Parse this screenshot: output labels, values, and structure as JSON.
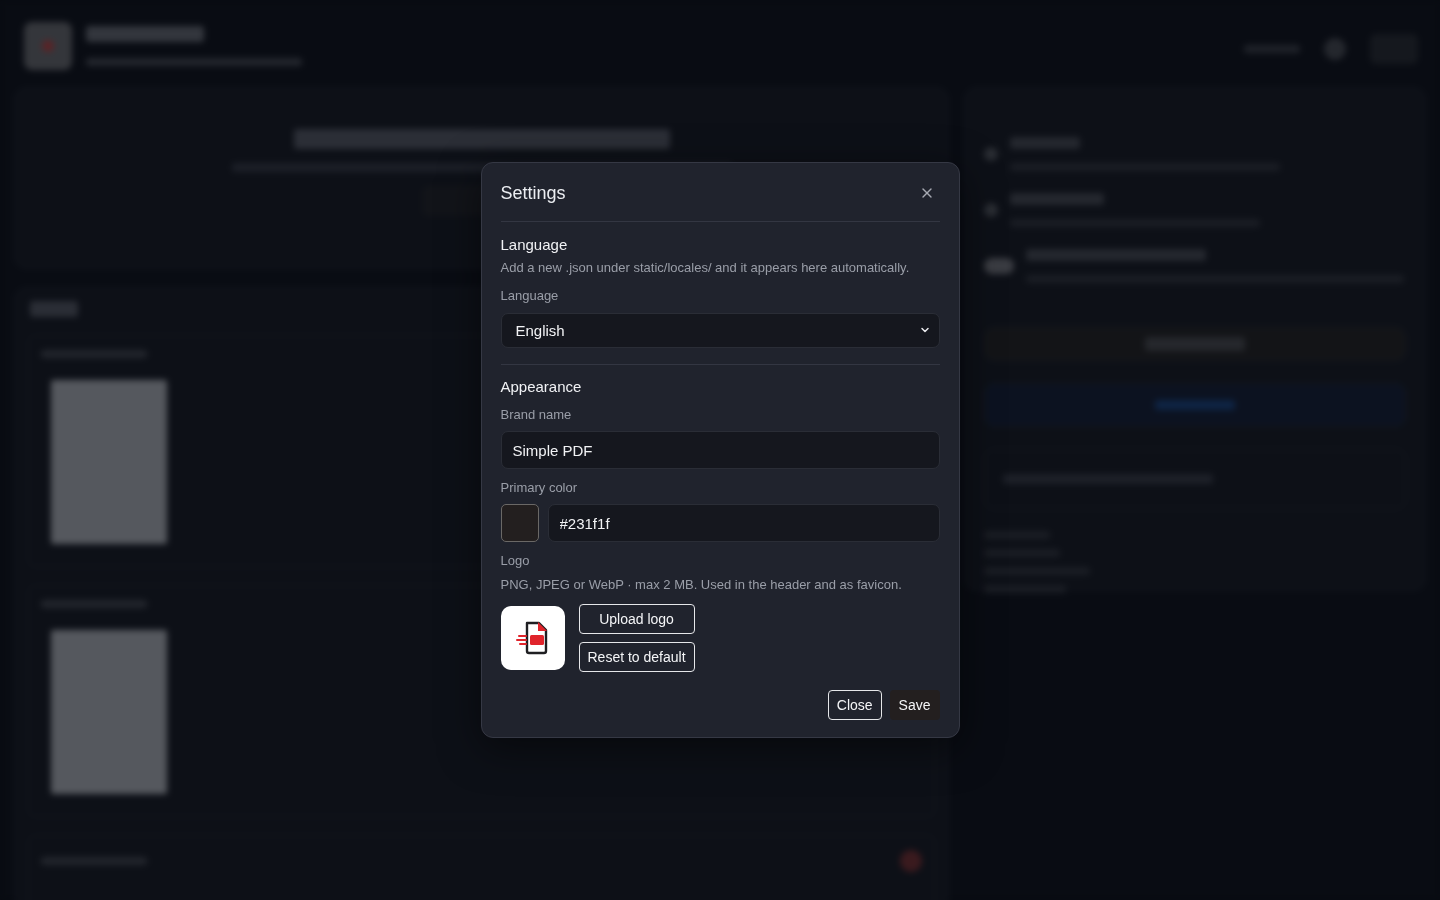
{
  "dialog": {
    "title": "Settings"
  },
  "language_section": {
    "heading": "Language",
    "hint": "Add a new .json under static/locales/ and it appears here automatically.",
    "field": {
      "label": "Language",
      "value": "English"
    }
  },
  "appearance_section": {
    "heading": "Appearance",
    "brand_name": {
      "label": "Brand name",
      "value": "Simple PDF"
    },
    "primary_color": {
      "label": "Primary color",
      "value": "#231f1f",
      "color": "#231f1f"
    },
    "logo": {
      "label": "Logo",
      "hint": "PNG, JPEG or WebP · max 2 MB. Used in the header and as favicon.",
      "buttons": [
        "Upload logo",
        "Reset to default"
      ]
    }
  },
  "footer_buttons": [
    {
      "label": "Close",
      "kind": "secondary"
    },
    {
      "label": "Save",
      "kind": "primary"
    }
  ]
}
